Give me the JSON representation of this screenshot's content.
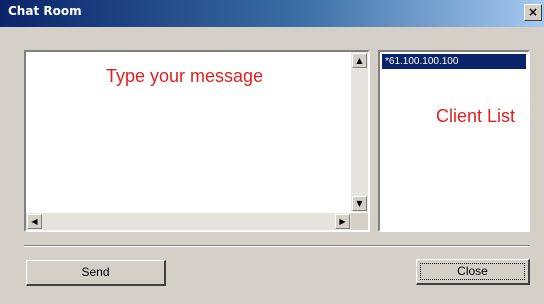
{
  "window": {
    "title": "Chat Room",
    "close_glyph": "×"
  },
  "message_area": {
    "value": "",
    "hint": "Type your message"
  },
  "client_list": {
    "items": [
      "*61.100.100.100"
    ],
    "hint": "Client List"
  },
  "buttons": {
    "send": "Send",
    "close": "Close"
  },
  "colors": {
    "title_bar": "#0a246a",
    "selection": "#0a246a",
    "hint_text": "#e0201f",
    "dialog_face": "#d4d0c8"
  },
  "icons": {
    "scroll_up": "▲",
    "scroll_down": "▼",
    "scroll_left": "◀",
    "scroll_right": "▶"
  }
}
